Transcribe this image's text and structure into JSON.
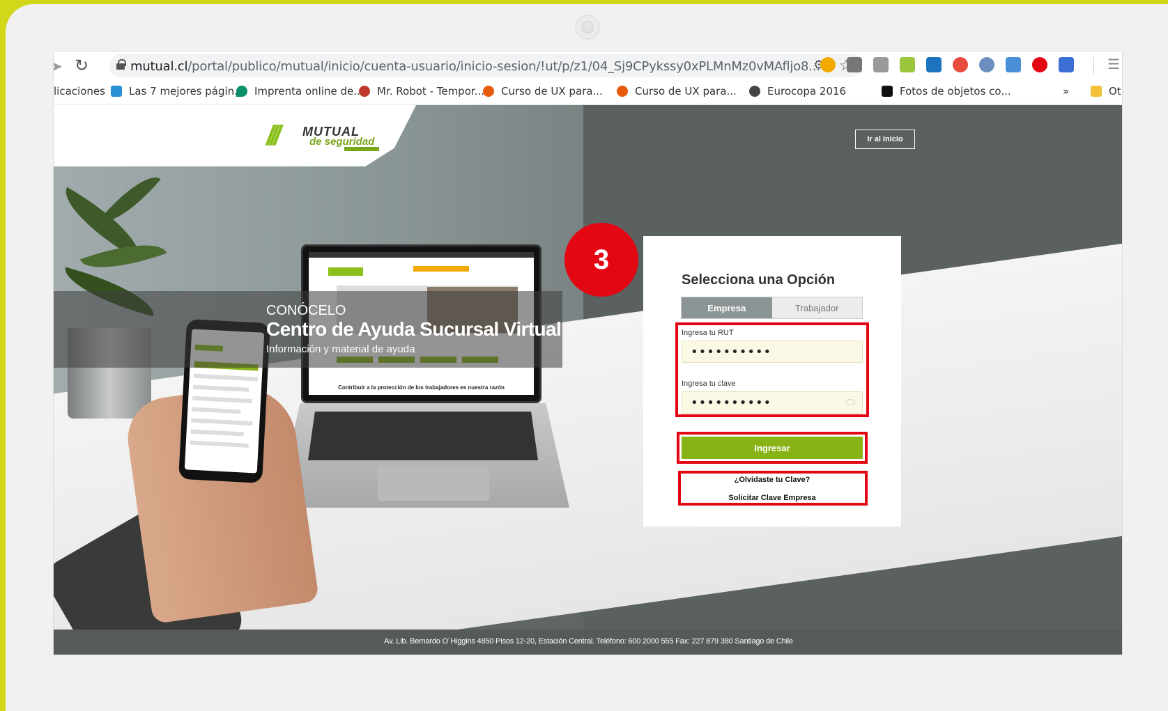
{
  "browser": {
    "url_domain": "mutual.cl",
    "url_path": "/portal/publico/mutual/inicio/cuenta-usuario/inicio-sesion/!ut/p/z1/04_Sj9CPykssy0xPLMnMz0vMAfljo8..."
  },
  "bookmarks": [
    {
      "label": "licaciones",
      "color": "transparent"
    },
    {
      "label": "Las 7 mejores págin...",
      "color": "#2b8fd6"
    },
    {
      "label": "Imprenta online de...",
      "color": "#0a8f6a"
    },
    {
      "label": "Mr. Robot - Tempor...",
      "color": "#c0392b"
    },
    {
      "label": "Curso de UX para...",
      "color": "#e8590c"
    },
    {
      "label": "Curso de UX para...",
      "color": "#e8590c"
    },
    {
      "label": "Eurocopa 2016",
      "color": "#444444"
    },
    {
      "label": "Fotos de objetos co...",
      "color": "#111111"
    },
    {
      "label": "»",
      "color": "transparent"
    },
    {
      "label": "Ot",
      "color": "#f3c13a"
    }
  ],
  "page": {
    "go_home": "Ir al Inicio",
    "banner_sub": "CONÓCELO",
    "banner_title": "Centro de Ayuda Sucursal Virtual",
    "banner_desc": "Información y material de ayuda",
    "laptop_caption": "Contribuir a la protección de los trabajadores es nuestra razón",
    "footer": "Av. Lib. Bernardo O´Higgins 4850 Pisos 12-20, Estación Central. Teléfono: 600 2000 555 Fax: 227 879 380 Santiago de Chile"
  },
  "logo": {
    "line1": "MUTUAL",
    "line2": "de seguridad"
  },
  "login": {
    "title": "Selecciona una Opción",
    "tabs": [
      {
        "label": "Empresa",
        "active": true
      },
      {
        "label": "Trabajador",
        "active": false
      }
    ],
    "rut_label": "Ingresa tu RUT",
    "rut_value": "••••••••••",
    "password_label": "Ingresa tu clave",
    "password_value": "••••••••••",
    "submit": "Ingresar",
    "forgot": "¿Olvidaste tu Clave?",
    "request": "Solicitar Clave Empresa"
  },
  "annotation": {
    "step": "3",
    "color": "#e30613"
  },
  "colors": {
    "brand_green": "#87b317",
    "frame": "#d2d719"
  }
}
